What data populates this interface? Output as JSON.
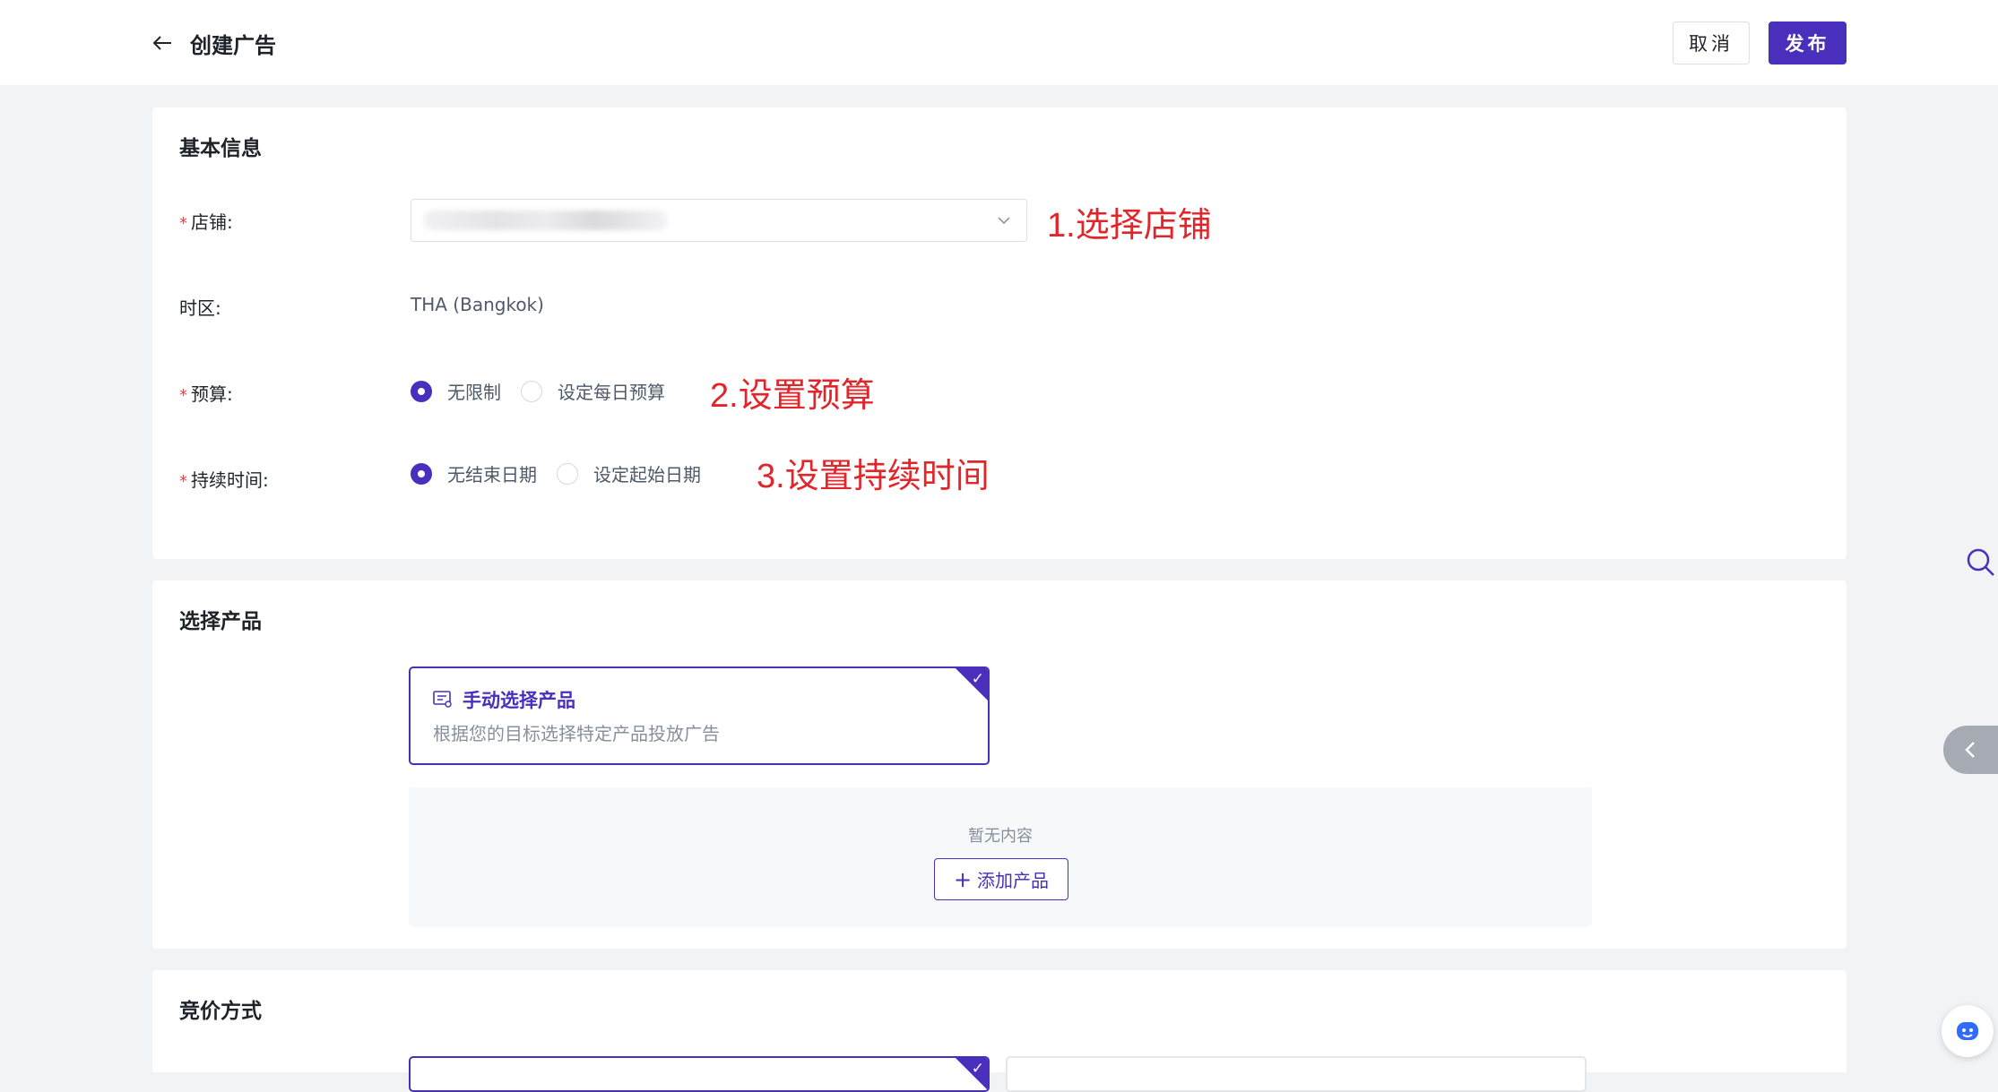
{
  "header": {
    "title": "创建广告",
    "cancel_label": "取消",
    "publish_label": "发布"
  },
  "basic_info": {
    "section_title": "基本信息",
    "store": {
      "label": "店铺:",
      "required": true,
      "value": "",
      "annotation": "1.选择店铺"
    },
    "timezone": {
      "label": "时区:",
      "value": "THA (Bangkok)"
    },
    "budget": {
      "label": "预算:",
      "required": true,
      "options": [
        "无限制",
        "设定每日预算"
      ],
      "selected": "无限制",
      "annotation": "2.设置预算"
    },
    "duration": {
      "label": "持续时间:",
      "required": true,
      "options": [
        "无结束日期",
        "设定起始日期"
      ],
      "selected": "无结束日期",
      "annotation": "3.设置持续时间"
    }
  },
  "select_product": {
    "section_title": "选择产品",
    "option": {
      "title": "手动选择产品",
      "description": "根据您的目标选择特定产品投放广告",
      "selected": true
    },
    "empty_text": "暂无内容",
    "add_button_label": "添加产品"
  },
  "bidding": {
    "section_title": "竞价方式"
  },
  "colors": {
    "primary": "#4a2fbd",
    "annotation": "#e0262b",
    "background": "#f2f3f5"
  },
  "icons": [
    "arrow-left-icon",
    "chevron-down-icon",
    "product-list-icon",
    "check-icon",
    "plus-icon",
    "search-icon",
    "chevron-left-icon",
    "bot-icon"
  ]
}
